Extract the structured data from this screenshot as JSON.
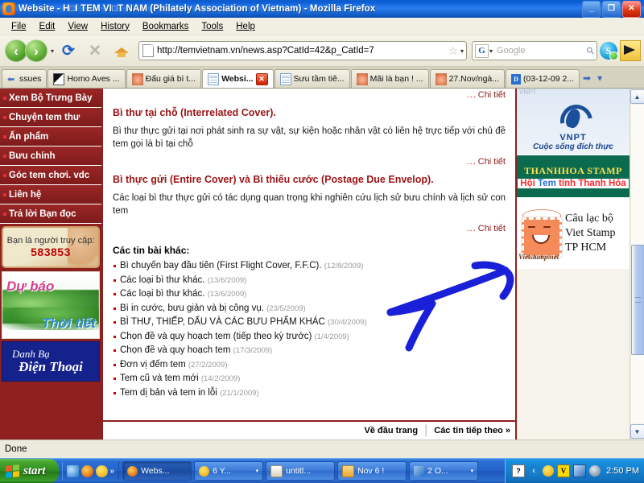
{
  "window": {
    "title": "Website - H□I TEM VI□T NAM (Philately Association of Vietnam) - Mozilla Firefox",
    "app_icon": "firefox-icon",
    "minimize_label": "_",
    "maximize_label": "❐",
    "close_label": "✕"
  },
  "menubar": {
    "items": [
      {
        "label": "File"
      },
      {
        "label": "Edit"
      },
      {
        "label": "View"
      },
      {
        "label": "History"
      },
      {
        "label": "Bookmarks"
      },
      {
        "label": "Tools"
      },
      {
        "label": "Help"
      }
    ]
  },
  "toolbar": {
    "back_label": "‹",
    "forward_label": "›",
    "history_caret": "▾",
    "reload_label": "⟳",
    "stop_label": "✕",
    "home_label": "Home",
    "url": "http://temvietnam.vn/news.asp?CatId=42&p_CatId=7",
    "bookmark_star": "☆",
    "bookmark_caret": "▾",
    "search_engine": "G",
    "search_caret": "▾",
    "search_placeholder": "Google",
    "search_value": "",
    "magnifier": "⚲",
    "skype_label": "S",
    "megaphone_label": "megaphone"
  },
  "tabs": {
    "scroll_left": "◀",
    "scroll_right": "➡",
    "list_caret": "▾",
    "items": [
      {
        "label": "ssues",
        "icon": "arrow-left-icon",
        "active": false
      },
      {
        "label": "Homo Aves ...",
        "icon": "homo-icon",
        "active": false
      },
      {
        "label": "Đấu giá bì t...",
        "icon": "stamp-icon",
        "active": false
      },
      {
        "label": "Websi...",
        "icon": "doc-icon",
        "active": true,
        "close": "✕"
      },
      {
        "label": "Sưu tầm tiê...",
        "icon": "doc-icon",
        "active": false
      },
      {
        "label": "Mãi là bạn ! ...",
        "icon": "stamp-icon",
        "active": false
      },
      {
        "label": "27.Nov/ngà...",
        "icon": "stamp-icon",
        "active": false
      },
      {
        "label": "(03-12-09 2...",
        "icon": "blue-d-icon",
        "active": false
      }
    ]
  },
  "left_sidebar": {
    "menu": [
      {
        "label": "Xem Bộ Trưng Bày"
      },
      {
        "label": "Chuyện tem thư"
      },
      {
        "label": "Ấn phẩm"
      },
      {
        "label": "Bưu chính"
      },
      {
        "label": "Góc tem chơi. vdc"
      },
      {
        "label": "Liên hệ"
      },
      {
        "label": "Trả lời Bạn đọc"
      }
    ],
    "counter": {
      "label": "Bạn là người truy cập:",
      "value": "583853"
    },
    "weather_banner": {
      "line1": "Dự báo",
      "line2": "Thời tiết"
    },
    "phone_banner": {
      "line1": "Danh Bạ",
      "line2": "Điện Thoại"
    }
  },
  "content": {
    "top_detail_link": "Chi tiết",
    "detail_dots": "...",
    "articles": [
      {
        "title": "Bì thư tại chỗ (Interrelated Cover).",
        "body": "Bì thư thực gửi tại nơi phát sinh ra sự vật, sự kiện hoặc nhân vật có liên hệ trực tiếp với chủ đề tem gọi là bì tại chỗ",
        "detail_link": "Chi tiết"
      },
      {
        "title": "Bì thực gửi (Entire Cover) và Bì thiếu cước (Postage Due Envelop).",
        "body": "Các loại bì thư thực gửi có tác dụng quan trọng khi nghiên cứu lịch sử bưu chính và lịch sử con tem",
        "detail_link": "Chi tiết"
      }
    ],
    "others_heading": "Các tin bài khác:",
    "news": [
      {
        "title": "Bì chuyến bay đầu tiên (First Flight Cover, F.F.C).",
        "date": "(12/8/2009)"
      },
      {
        "title": "Các loại bì thư khác.",
        "date": "(13/6/2009)"
      },
      {
        "title": "Các loại bì thư khác.",
        "date": "(13/6/2009)"
      },
      {
        "title": "Bì in cước, bưu giản và bị công vụ.",
        "date": "(23/5/2009)"
      },
      {
        "title": "BÌ THƯ, THIẾP, DẤU VÀ CÁC BƯU PHẨM KHÁC",
        "date": "(30/4/2009)"
      },
      {
        "title": "Chọn đề và quy hoạch tem (tiếp theo kỳ trước)",
        "date": "(1/4/2009)"
      },
      {
        "title": "Chọn đề và quy hoạch tem",
        "date": "(17/3/2009)"
      },
      {
        "title": "Đơn vị đếm tem",
        "date": "(27/2/2009)"
      },
      {
        "title": "Tem cũ và tem mới",
        "date": "(14/2/2009)"
      },
      {
        "title": "Tem dị bản và tem in lỗi",
        "date": "(21/1/2009)"
      }
    ],
    "footer": {
      "top_link": "Về đầu trang",
      "separator": "|",
      "next_link": "Các tin tiếp theo »"
    }
  },
  "right_sidebar": {
    "vnpt": {
      "watermark": "VNPT",
      "name": "VNPT",
      "slogan": "Cuộc sống đích thực"
    },
    "thanhhoa": {
      "line1": "THANHHOA STAMP",
      "line2_a": "Hội ",
      "line2_b": "Tem",
      "line2_c": " tỉnh Thanh Hóa"
    },
    "vietstamp": {
      "line1": "Câu lạc bộ",
      "line2": "Viet Stamp",
      "line3": "TP HCM",
      "url_text": "Vietstamp.net"
    }
  },
  "scrollbar": {
    "up_arrow": "▲",
    "down_arrow": "▼"
  },
  "statusbar": {
    "text": "Done"
  },
  "taskbar": {
    "start_label": "start",
    "quicklaunch": [
      {
        "name": "ie-icon"
      },
      {
        "name": "firefox-icon"
      },
      {
        "name": "yahoo-messenger-icon"
      }
    ],
    "quicklaunch_more": "»",
    "buttons": [
      {
        "label": "Webs...",
        "icon": "firefox-icon",
        "active": true,
        "caret": ""
      },
      {
        "label": "6 Y...",
        "icon": "yahoo-messenger-icon",
        "active": false,
        "caret": "▾"
      },
      {
        "label": "untitl...",
        "icon": "notepad-icon",
        "active": false,
        "caret": ""
      },
      {
        "label": "Nov 6 !",
        "icon": "folder-icon",
        "active": false,
        "caret": ""
      },
      {
        "label": "2 O...",
        "icon": "image-icon",
        "active": false,
        "caret": "▾"
      }
    ],
    "tray": [
      {
        "name": "help-icon",
        "glyph": "?"
      },
      {
        "name": "show-hidden-icons-icon",
        "glyph": "‹"
      },
      {
        "name": "yahoo-messenger-tray-icon",
        "glyph": ""
      },
      {
        "name": "vietkey-icon",
        "glyph": "V"
      },
      {
        "name": "network-icon",
        "glyph": ""
      },
      {
        "name": "volume-icon",
        "glyph": ""
      }
    ],
    "clock": "2:50 PM"
  }
}
